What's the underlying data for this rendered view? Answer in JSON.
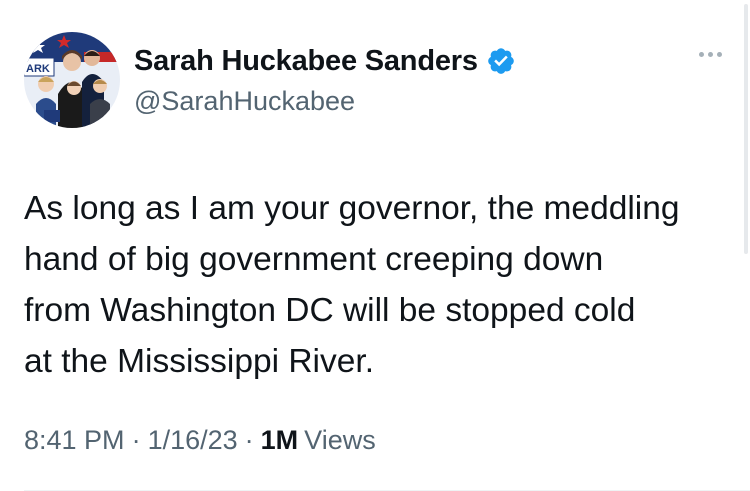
{
  "author": {
    "display_name": "Sarah Huckabee Sanders",
    "handle": "@SarahHuckabee",
    "verified": true,
    "avatar_icon": "family-photo-avatar",
    "avatar_sign_text": "ARK"
  },
  "tweet": {
    "text": "As long as I am your governor, the meddling\nhand of big government creeping down\nfrom Washington DC will be stopped cold\nat the Mississippi River.",
    "time": "8:41 PM",
    "date": "1/16/23",
    "views_count": "1M",
    "views_label": "Views",
    "separator": "·"
  },
  "colors": {
    "text_primary": "#0f1419",
    "text_secondary": "#536471",
    "verified_badge": "#1d9bf0",
    "background": "#ffffff"
  }
}
